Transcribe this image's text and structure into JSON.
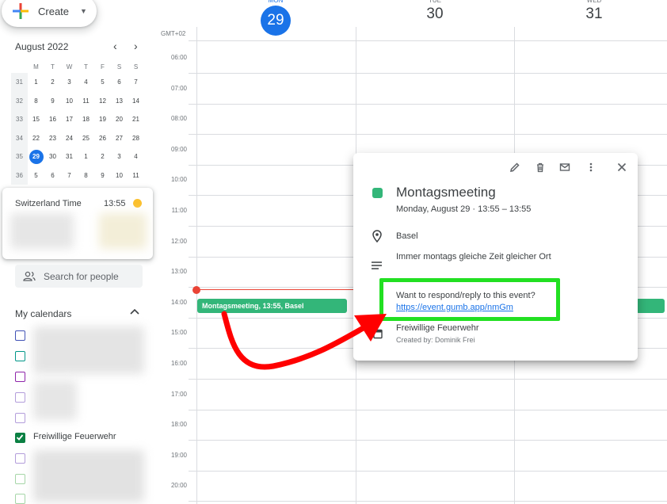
{
  "create": {
    "label": "Create"
  },
  "mini_calendar": {
    "title": "August 2022",
    "weekdays": [
      "M",
      "T",
      "W",
      "T",
      "F",
      "S",
      "S"
    ],
    "weeks": [
      {
        "wk": "31",
        "days": [
          "1",
          "2",
          "3",
          "4",
          "5",
          "6",
          "7"
        ]
      },
      {
        "wk": "32",
        "days": [
          "8",
          "9",
          "10",
          "11",
          "12",
          "13",
          "14"
        ]
      },
      {
        "wk": "33",
        "days": [
          "15",
          "16",
          "17",
          "18",
          "19",
          "20",
          "21"
        ]
      },
      {
        "wk": "34",
        "days": [
          "22",
          "23",
          "24",
          "25",
          "26",
          "27",
          "28"
        ]
      },
      {
        "wk": "35",
        "days": [
          "29",
          "30",
          "31",
          "1",
          "2",
          "3",
          "4"
        ]
      },
      {
        "wk": "36",
        "days": [
          "5",
          "6",
          "7",
          "8",
          "9",
          "10",
          "11"
        ]
      }
    ],
    "today": "29"
  },
  "world_clock": {
    "zone": "Switzerland Time",
    "time": "13:55"
  },
  "search_people": {
    "placeholder": "Search for people"
  },
  "my_calendars": {
    "title": "My calendars",
    "items": [
      {
        "label": "",
        "color": "#3f51b5",
        "checked": false
      },
      {
        "label": "",
        "color": "#009688",
        "checked": false
      },
      {
        "label": "",
        "color": "#8e24aa",
        "checked": false
      },
      {
        "label": "",
        "color": "#b39ddb",
        "checked": false
      },
      {
        "label": "",
        "color": "#b39ddb",
        "checked": false
      },
      {
        "label": "Freiwillige Feuerwehr",
        "color": "#0b8043",
        "checked": true
      },
      {
        "label": "",
        "color": "#b39ddb",
        "checked": false
      },
      {
        "label": "",
        "color": "#a5d6a7",
        "checked": false
      },
      {
        "label": "",
        "color": "#a5d6a7",
        "checked": false
      }
    ]
  },
  "week_view": {
    "timezone": "GMT+02",
    "days": [
      {
        "name": "MON",
        "num": "29",
        "today": true
      },
      {
        "name": "TUE",
        "num": "30",
        "today": false
      },
      {
        "name": "WED",
        "num": "31",
        "today": false
      }
    ],
    "hours": [
      "06:00",
      "07:00",
      "08:00",
      "09:00",
      "10:00",
      "11:00",
      "12:00",
      "13:00",
      "14:00",
      "15:00",
      "16:00",
      "17:00",
      "18:00",
      "19:00",
      "20:00"
    ],
    "event_chip": "Montagsmeeting, 13:55, Basel"
  },
  "popup": {
    "title": "Montagsmeeting",
    "when": "Monday, August 29  ·  13:55 – 13:55",
    "location": "Basel",
    "description": "Immer montags gleiche Zeit gleicher Ort",
    "question": "Want to respond/reply to this event?",
    "link": "https://event.gumb.app/nmGm",
    "calendar": "Freiwillige Feuerwehr",
    "creator": "Created by: Dominik Frei",
    "event_color": "#33b679"
  },
  "annotation": {
    "box_color": "#22e022",
    "arrow_color": "#ff0000"
  }
}
